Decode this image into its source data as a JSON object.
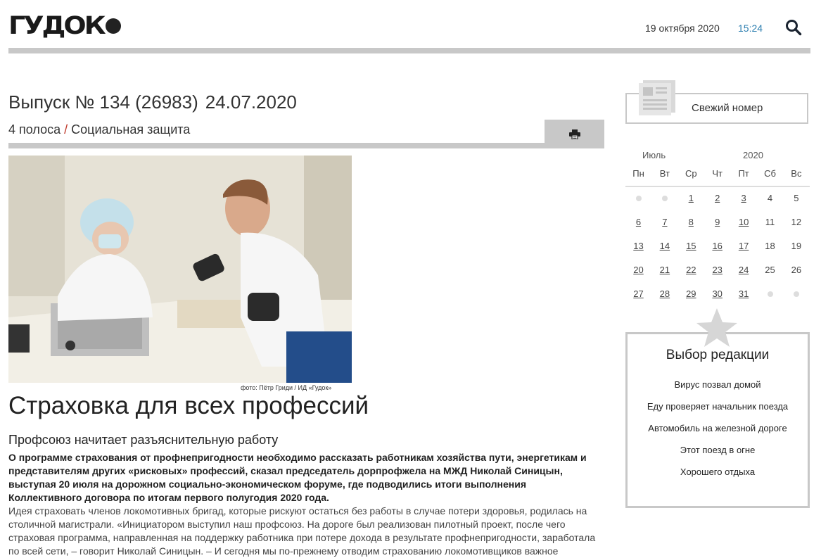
{
  "header": {
    "logo_text": "ГУДОК",
    "date": "19 октября 2020",
    "time": "15:24",
    "search_icon": "search-icon"
  },
  "issue": {
    "number": "Выпуск № 134 (26983)",
    "date": "24.07.2020",
    "page": "4 полоса",
    "separator": "/",
    "section": "Социальная защита",
    "print_icon": "print-icon"
  },
  "article": {
    "photo_credit": "фото: Пётр Гриди / ИД «Гудок»",
    "title": "Страховка для всех профессий",
    "subtitle": "Профсоюз начитает разъяснительную работу",
    "lead": "О программе страхования от профнепригодности необходимо рассказать работникам хозяйства пути, энергетикам и представителям других «рисковых» профессий, сказал председатель дорпрофжела на МЖД Николай Синицын, выступая 20 июля на дорожном социально-экономическом форуме, где подводились итоги выполнения Коллективного договора по итогам первого полугодия 2020 года.",
    "body": "Идея страховать членов локомотивных бригад, которые рискуют остаться без работы в случае потери здоровья, родилась на столичной магистрали. «Инициатором выступил наш профсоюз. На дороге был реализован пилотный проект, после чего страховая программа, направленная на поддержку работника при потере дохода в результате профнепригодности, заработала по всей сети, – говорит Николай Синицын. – И сегодня мы по-прежнему отводим страхованию локомотивщиков важное"
  },
  "sidebar": {
    "fresh_issue": "Свежий номер",
    "calendar": {
      "month": "Июль",
      "year": "2020",
      "weekdays": [
        "Пн",
        "Вт",
        "Ср",
        "Чт",
        "Пт",
        "Сб",
        "Вс"
      ],
      "weeks": [
        [
          "",
          "",
          "1",
          "2",
          "3",
          "4",
          "5"
        ],
        [
          "6",
          "7",
          "8",
          "9",
          "10",
          "11",
          "12"
        ],
        [
          "13",
          "14",
          "15",
          "16",
          "17",
          "18",
          "19"
        ],
        [
          "20",
          "21",
          "22",
          "23",
          "24",
          "25",
          "26"
        ],
        [
          "27",
          "28",
          "29",
          "30",
          "31",
          "",
          ""
        ]
      ],
      "linked_days": [
        "1",
        "2",
        "3",
        "6",
        "7",
        "8",
        "9",
        "10",
        "13",
        "14",
        "15",
        "16",
        "17",
        "20",
        "21",
        "22",
        "23",
        "24",
        "27",
        "28",
        "29",
        "30",
        "31"
      ]
    },
    "editors_choice": {
      "title": "Выбор редакции",
      "items": [
        "Вирус позвал домой",
        "Еду проверяет начальник поезда",
        "Автомобиль на железной дороге",
        "Этот поезд в огне",
        "Хорошего отдыха"
      ]
    }
  }
}
